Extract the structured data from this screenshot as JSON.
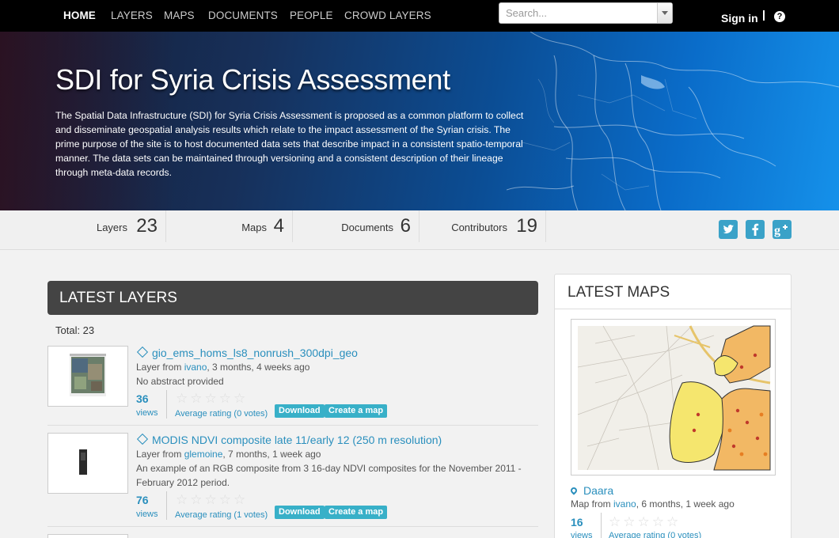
{
  "nav": {
    "items": [
      "HOME",
      "LAYERS",
      "MAPS",
      "DOCUMENTS",
      "PEOPLE",
      "CROWD LAYERS"
    ],
    "active": "HOME",
    "search_placeholder": "Search...",
    "signin": "Sign in",
    "help": "?"
  },
  "hero": {
    "title": "SDI for Syria Crisis Assessment",
    "description": "The Spatial Data Infrastructure (SDI) for Syria Crisis Assessment is proposed as a common platform to collect and disseminate geospatial analysis results which relate to the impact assessment of the Syrian crisis. The prime purpose of the site is to host documented data sets that describe impact in a consistent spatio-temporal manner. The data sets can be maintained through versioning and a consistent description of their lineage through meta-data records."
  },
  "stats": [
    {
      "label": "Layers",
      "value": "23"
    },
    {
      "label": "Maps",
      "value": "4"
    },
    {
      "label": "Documents",
      "value": "6"
    },
    {
      "label": "Contributors",
      "value": "19"
    }
  ],
  "social": {
    "twitter": "twitter-icon",
    "facebook": "facebook-icon",
    "google": "google-plus-icon"
  },
  "latest_layers": {
    "title": "LATEST LAYERS",
    "total": "Total: 23",
    "items": [
      {
        "title": "gio_ems_homs_ls8_nonrush_300dpi_geo",
        "meta_prefix": "Layer from ",
        "owner": "ivano",
        "meta_suffix": ", 3 months, 4 weeks ago",
        "abstract": "No abstract provided",
        "views": "36",
        "views_label": "views",
        "rating": "Average rating (0 votes)",
        "download": "Download",
        "create_map": "Create a map"
      },
      {
        "title": "MODIS NDVI composite late 11/early 12 (250 m resolution)",
        "meta_prefix": "Layer from ",
        "owner": "glemoine",
        "meta_suffix": ", 7 months, 1 week ago",
        "abstract": "An example of an RGB composite from 3 16-day NDVI composites for the November 2011 - February 2012 period.",
        "views": "76",
        "views_label": "views",
        "rating": "Average rating (1 votes)",
        "download": "Download",
        "create_map": "Create a map"
      }
    ]
  },
  "latest_maps": {
    "title": "LATEST MAPS",
    "items": [
      {
        "name": "Daara",
        "meta_prefix": "Map from ",
        "owner": "ivano",
        "meta_suffix": ", 6 months, 1 week ago",
        "views": "16",
        "views_label": "views",
        "rating": "Average rating (0 votes)"
      }
    ]
  },
  "colors": {
    "accent": "#2a8fbd",
    "button": "#38b0c8",
    "nav_bg": "#000000",
    "header_dark": "#444444"
  }
}
